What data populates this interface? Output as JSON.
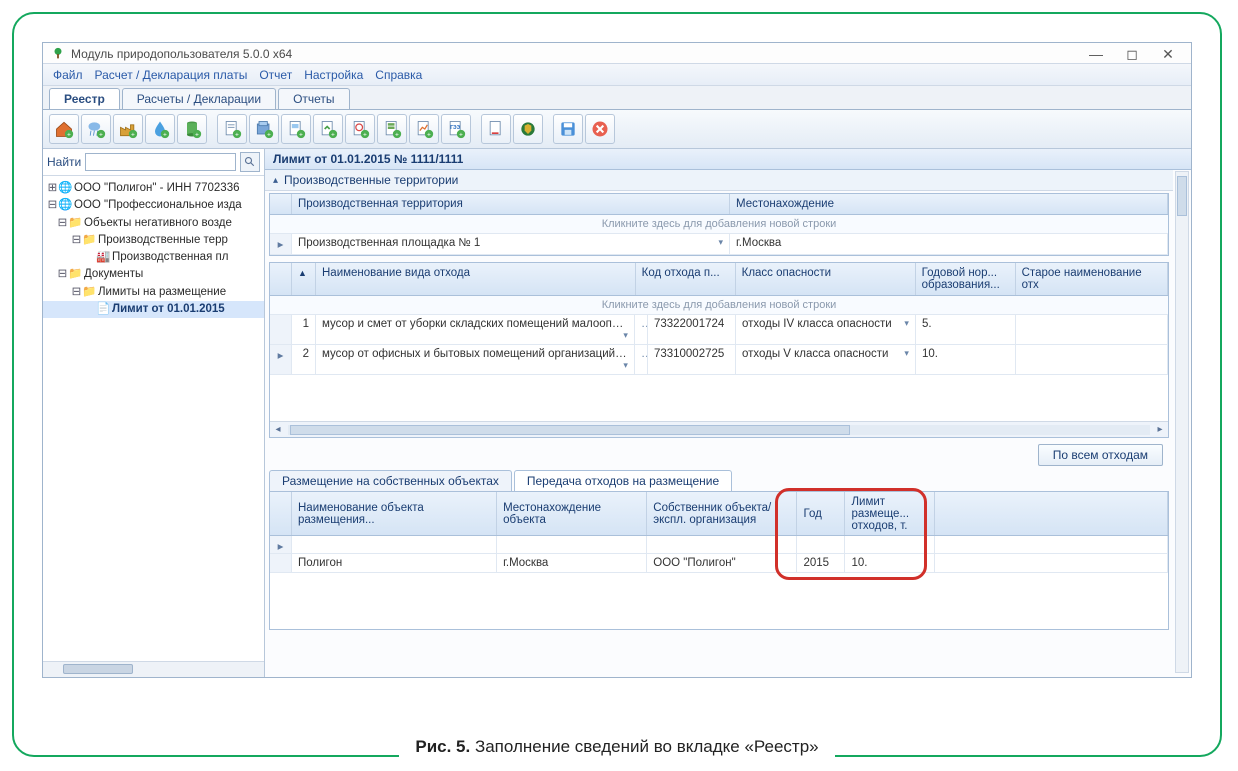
{
  "window": {
    "title": "Модуль природопользователя 5.0.0 x64"
  },
  "menu": {
    "file": "Файл",
    "calc": "Расчет / Декларация платы",
    "report": "Отчет",
    "settings": "Настройка",
    "help": "Справка"
  },
  "main_tabs": {
    "registry": "Реестр",
    "calcs": "Расчеты / Декларации",
    "reports": "Отчеты"
  },
  "find": {
    "label": "Найти",
    "placeholder": ""
  },
  "tree": {
    "org1": "ООО \"Полигон\" - ИНН 7702336",
    "org2": "ООО \"Профессиональное изда",
    "objects": "Объекты негативного возде",
    "prod_terr": "Производственные терр",
    "prod_area": "Производственная пл",
    "docs": "Документы",
    "limits": "Лимиты на размещение",
    "limit_item": "Лимит от 01.01.2015"
  },
  "panel": {
    "title": "Лимит от 01.01.2015 № 1111/1111",
    "section1": "Производственные территории",
    "grid1": {
      "col_territory": "Производственная территория",
      "col_location": "Местонахождение",
      "new_hint": "Кликните здесь для добавления новой строки",
      "row1": {
        "territory": "Производственная площадка № 1",
        "location": "г.Москва"
      }
    },
    "grid2": {
      "col_num": "",
      "col_name": "Наименование вида отхода",
      "col_code": "Код отхода п...",
      "col_danger": "Класс опасности",
      "col_norm": "Годовой нор... образования...",
      "col_old": "Старое наименование отх",
      "new_hint": "Кликните здесь для добавления новой строки",
      "row1": {
        "num": "1",
        "name": "мусор и смет от уборки складских помещений малоопасный",
        "code": "73322001724",
        "danger": "отходы IV класса опасности",
        "norm": "5."
      },
      "row2": {
        "num": "2",
        "name": "мусор от офисных и бытовых помещений организаций практиче...",
        "code": "73310002725",
        "danger": "отходы V класса опасности",
        "norm": "10."
      }
    },
    "btn_all_waste": "По всем отходам",
    "sub_tabs": {
      "own": "Размещение на собственных объектах",
      "transfer": "Передача отходов на размещение"
    },
    "grid3": {
      "col_obj": "Наименование объекта размещения...",
      "col_loc": "Местонахождение объекта",
      "col_owner": "Собственник объекта/ экспл. организация",
      "col_year": "Год",
      "col_limit": "Лимит размеще... отходов, т.",
      "row1": {
        "obj": "Полигон",
        "loc": "г.Москва",
        "owner": "ООО \"Полигон\"",
        "year": "2015",
        "limit": "10."
      }
    }
  },
  "caption": {
    "prefix": "Рис. 5.",
    "text": " Заполнение сведений во вкладке «Реестр»"
  }
}
